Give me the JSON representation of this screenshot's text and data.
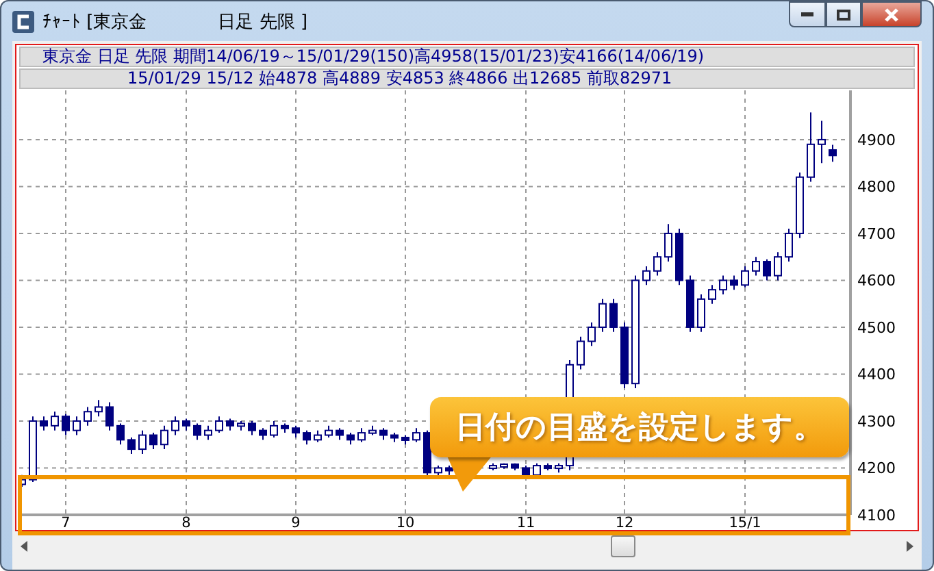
{
  "window": {
    "title": "ﾁｬｰﾄ [東京金　　　　日足 先限 ]"
  },
  "header": {
    "summary": "東京金 日足 先限 期間14/06/19～15/01/29(150)高4958(15/01/23)安4166(14/06/19)",
    "latest": "15/01/29 15/12 始4878 高4889 安4853 終4866 出12685 前取82971"
  },
  "chart": {
    "chart_data": {
      "type": "candlestick",
      "categories": [
        null,
        null,
        null,
        null,
        "7",
        null,
        null,
        null,
        null,
        null,
        null,
        null,
        null,
        null,
        null,
        "8",
        null,
        null,
        null,
        null,
        null,
        null,
        null,
        null,
        null,
        "9",
        null,
        null,
        null,
        null,
        null,
        null,
        null,
        null,
        null,
        "10",
        null,
        null,
        null,
        null,
        null,
        null,
        null,
        null,
        null,
        null,
        "11",
        null,
        null,
        null,
        null,
        null,
        null,
        null,
        null,
        "12",
        null,
        null,
        null,
        null,
        null,
        null,
        null,
        null,
        null,
        null,
        "15/1",
        null,
        null,
        null,
        null,
        null,
        null,
        null,
        null
      ],
      "ohlc": [
        [
          4165,
          4185,
          4160,
          4175
        ],
        [
          4175,
          4310,
          4170,
          4300
        ],
        [
          4300,
          4310,
          4280,
          4290
        ],
        [
          4290,
          4320,
          4280,
          4310
        ],
        [
          4310,
          4315,
          4270,
          4280
        ],
        [
          4280,
          4310,
          4270,
          4300
        ],
        [
          4300,
          4330,
          4290,
          4320
        ],
        [
          4320,
          4345,
          4310,
          4330
        ],
        [
          4330,
          4340,
          4280,
          4290
        ],
        [
          4290,
          4295,
          4250,
          4260
        ],
        [
          4260,
          4265,
          4230,
          4240
        ],
        [
          4240,
          4280,
          4230,
          4270
        ],
        [
          4270,
          4275,
          4240,
          4250
        ],
        [
          4250,
          4290,
          4240,
          4280
        ],
        [
          4280,
          4310,
          4270,
          4300
        ],
        [
          4300,
          4305,
          4280,
          4290
        ],
        [
          4290,
          4295,
          4260,
          4270
        ],
        [
          4270,
          4290,
          4260,
          4280
        ],
        [
          4280,
          4310,
          4275,
          4300
        ],
        [
          4300,
          4305,
          4280,
          4290
        ],
        [
          4290,
          4300,
          4280,
          4295
        ],
        [
          4295,
          4300,
          4270,
          4280
        ],
        [
          4280,
          4285,
          4260,
          4270
        ],
        [
          4270,
          4300,
          4265,
          4290
        ],
        [
          4290,
          4295,
          4275,
          4285
        ],
        [
          4285,
          4290,
          4265,
          4275
        ],
        [
          4275,
          4280,
          4250,
          4260
        ],
        [
          4260,
          4280,
          4255,
          4270
        ],
        [
          4270,
          4290,
          4265,
          4280
        ],
        [
          4280,
          4285,
          4260,
          4270
        ],
        [
          4270,
          4275,
          4250,
          4260
        ],
        [
          4260,
          4285,
          4255,
          4275
        ],
        [
          4275,
          4290,
          4270,
          4280
        ],
        [
          4280,
          4285,
          4260,
          4270
        ],
        [
          4270,
          4275,
          4255,
          4265
        ],
        [
          4265,
          4270,
          4250,
          4260
        ],
        [
          4260,
          4285,
          4255,
          4275
        ],
        [
          4275,
          4280,
          4180,
          4190
        ],
        [
          4190,
          4205,
          4180,
          4200
        ],
        [
          4200,
          4205,
          4185,
          4195
        ],
        null,
        null,
        null,
        [
          4200,
          4210,
          4195,
          4205
        ],
        [
          4205,
          4210,
          4198,
          4208
        ],
        [
          4208,
          4210,
          4195,
          4200
        ],
        [
          4200,
          4205,
          4180,
          4185
        ],
        [
          4185,
          4210,
          4180,
          4205
        ],
        [
          4205,
          4210,
          4195,
          4200
        ],
        [
          4200,
          4210,
          4190,
          4205
        ],
        [
          4205,
          4430,
          4195,
          4420
        ],
        [
          4420,
          4480,
          4410,
          4470
        ],
        [
          4470,
          4510,
          4460,
          4500
        ],
        [
          4500,
          4560,
          4490,
          4550
        ],
        [
          4550,
          4560,
          4490,
          4500
        ],
        [
          4500,
          4510,
          4370,
          4380
        ],
        [
          4380,
          4610,
          4370,
          4600
        ],
        [
          4600,
          4630,
          4590,
          4620
        ],
        [
          4620,
          4660,
          4610,
          4650
        ],
        [
          4650,
          4720,
          4640,
          4700
        ],
        [
          4700,
          4710,
          4590,
          4600
        ],
        [
          4600,
          4610,
          4490,
          4500
        ],
        [
          4500,
          4570,
          4490,
          4560
        ],
        [
          4560,
          4590,
          4550,
          4580
        ],
        [
          4580,
          4610,
          4570,
          4600
        ],
        [
          4600,
          4610,
          4580,
          4590
        ],
        [
          4590,
          4630,
          4585,
          4620
        ],
        [
          4620,
          4650,
          4610,
          4640
        ],
        [
          4640,
          4645,
          4600,
          4610
        ],
        [
          4610,
          4660,
          4600,
          4650
        ],
        [
          4650,
          4710,
          4640,
          4700
        ],
        [
          4700,
          4830,
          4690,
          4820
        ],
        [
          4820,
          4958,
          4810,
          4890
        ],
        [
          4890,
          4940,
          4850,
          4900
        ],
        [
          4878,
          4889,
          4853,
          4866
        ]
      ],
      "ylim": [
        4100,
        5005
      ],
      "grid": true,
      "yticks": [
        4100,
        4200,
        4300,
        4400,
        4500,
        4600,
        4700,
        4800,
        4900
      ]
    }
  },
  "callout": {
    "text": "日付の目盛を設定します。"
  }
}
